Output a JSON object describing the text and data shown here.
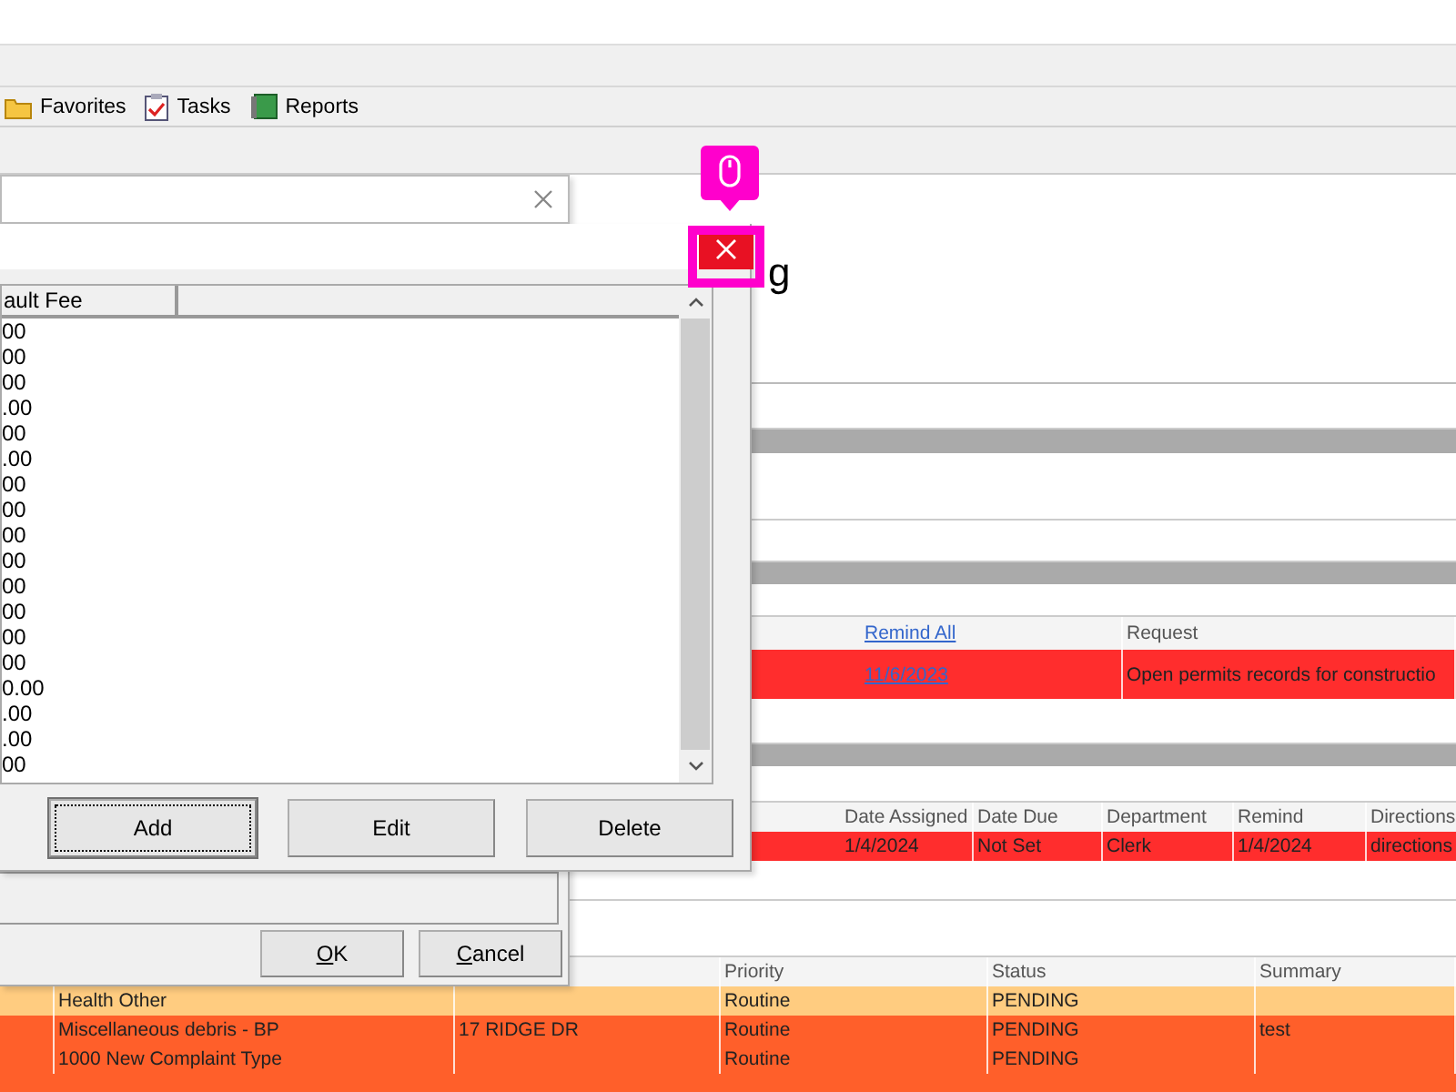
{
  "toolbar": [
    {
      "kind": "folder",
      "label": "Favorites"
    },
    {
      "kind": "clipboard",
      "label": "Tasks"
    },
    {
      "kind": "book",
      "label": "Reports"
    }
  ],
  "heading": {
    "text": "g"
  },
  "requests_table": {
    "remind_all": "Remind All",
    "request_header": "Request",
    "rows": [
      {
        "remind": "11/6/2023",
        "request": "Open permits records for constructio"
      }
    ]
  },
  "tasks_table": {
    "columns": [
      "Date Assigned",
      "Date Due",
      "Department",
      "Remind",
      "Directions"
    ],
    "rows": [
      [
        "1/4/2024",
        "Not Set",
        "Clerk",
        "1/4/2024",
        "directions"
      ]
    ]
  },
  "complaints_table": {
    "columns": [
      "",
      "",
      "",
      "Priority",
      "Status",
      "Summary"
    ],
    "rows": [
      {
        "color": "#ffcc80",
        "cells": [
          "",
          "Health Other",
          "",
          "Routine",
          "PENDING",
          ""
        ]
      },
      {
        "color": "#ff5f2a",
        "cells": [
          "",
          "Miscellaneous debris - BP",
          "17 RIDGE DR",
          "Routine",
          "PENDING",
          "test"
        ]
      },
      {
        "color": "#ff5f2a",
        "cells": [
          "",
          "1000 New Complaint Type",
          "",
          "Routine",
          "PENDING",
          ""
        ]
      }
    ]
  },
  "fee_dialog": {
    "column_header": "ault Fee",
    "values": [
      "00",
      "00",
      "00",
      ".00",
      "00",
      ".00",
      "00",
      "00",
      "00",
      "00",
      "00",
      "00",
      "00",
      "00",
      "0.00",
      ".00",
      ".00",
      "00"
    ],
    "buttons": [
      {
        "label": "Add",
        "focused": true
      },
      {
        "label": "Edit",
        "focused": false
      },
      {
        "label": "Delete",
        "focused": false
      }
    ]
  },
  "outer_dialog": {
    "buttons": [
      {
        "label": "OK"
      },
      {
        "label": "Cancel"
      }
    ]
  }
}
